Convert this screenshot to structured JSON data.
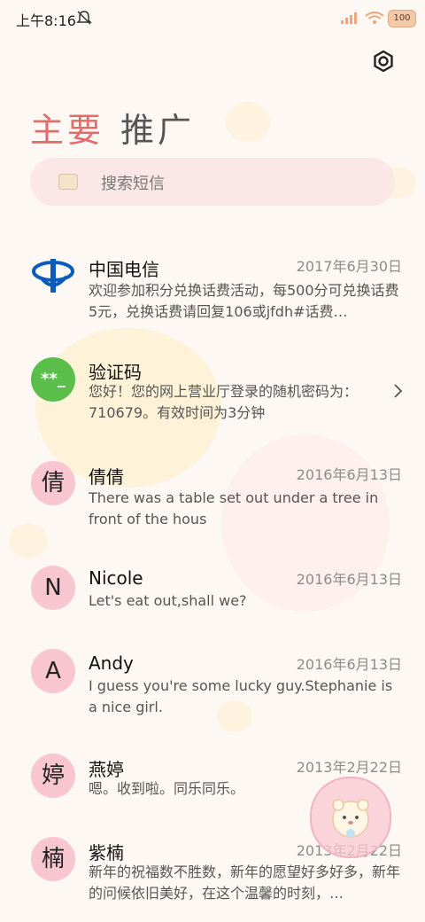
{
  "status_bar": {
    "time": "上午8:16",
    "battery": "100",
    "icons": [
      "bell-muted-icon",
      "signal-icon",
      "wifi-icon",
      "battery-icon"
    ]
  },
  "header": {
    "settings_icon": "gear-icon"
  },
  "tabs": [
    {
      "label": "主要",
      "active": true
    },
    {
      "label": "推广",
      "active": false
    }
  ],
  "search": {
    "placeholder": "搜索短信",
    "icon": "search-icon"
  },
  "colors": {
    "active_tab": "#e26b6b",
    "avatar_pink": "#f8c6d0",
    "verify_green": "#59bf4a",
    "telecom_blue": "#0b5bbd"
  },
  "messages": [
    {
      "sender": "中国电信",
      "date": "2017年6月30日",
      "preview": "欢迎参加积分兑换话费活动，每500分可兑换话费5元，兑换话费请回复106或jfdh#话费…",
      "avatar": "telecom-logo-icon"
    },
    {
      "sender": "验证码",
      "date": "",
      "preview": "您好！您的网上营业厅登录的随机密码为：710679。有效时间为3分钟",
      "avatar": "**_"
    },
    {
      "sender": "倩倩",
      "date": "2016年6月13日",
      "preview": "There was a table set out under a tree in front of the hous",
      "avatar": "倩"
    },
    {
      "sender": "Nicole",
      "date": "2016年6月13日",
      "preview": "Let's eat out,shall we?",
      "avatar": "N"
    },
    {
      "sender": "Andy",
      "date": "2016年6月13日",
      "preview": "I guess you're some lucky guy.Stephanie is a nice girl.",
      "avatar": "A"
    },
    {
      "sender": "燕婷",
      "date": "2013年2月22日",
      "preview": "嗯。收到啦。同乐同乐。",
      "avatar": "婷"
    },
    {
      "sender": "紫楠",
      "date": "2013年2月22日",
      "preview": "新年的祝福数不胜数，新年的愿望好多好多，新年的问候依旧美好，在这个温馨的时刻，…",
      "avatar": "楠"
    }
  ]
}
